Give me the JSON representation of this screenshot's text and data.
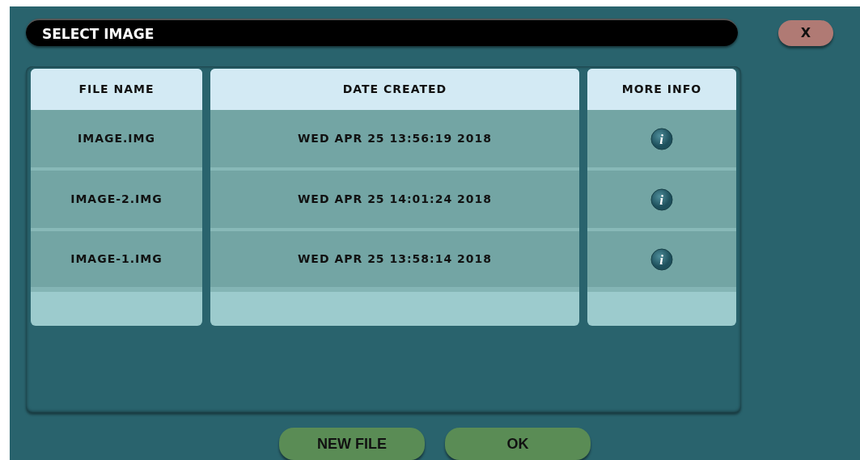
{
  "window": {
    "title": "SELECT IMAGE",
    "close_label": "X"
  },
  "table": {
    "columns": [
      {
        "label": "FILE NAME",
        "kind": "text"
      },
      {
        "label": "DATE CREATED",
        "kind": "text"
      },
      {
        "label": "MORE INFO",
        "kind": "info"
      }
    ],
    "rows": [
      {
        "cells": [
          "IMAGE.IMG",
          "WED APR 25 13:56:19 2018",
          "i"
        ]
      },
      {
        "cells": [
          "IMAGE-2.IMG",
          "WED APR 25 14:01:24 2018",
          "i"
        ]
      },
      {
        "cells": [
          "IMAGE-1.IMG",
          "WED APR 25 13:58:14 2018",
          "i"
        ]
      }
    ]
  },
  "buttons": [
    {
      "label": "NEW FILE"
    },
    {
      "label": "OK"
    }
  ]
}
